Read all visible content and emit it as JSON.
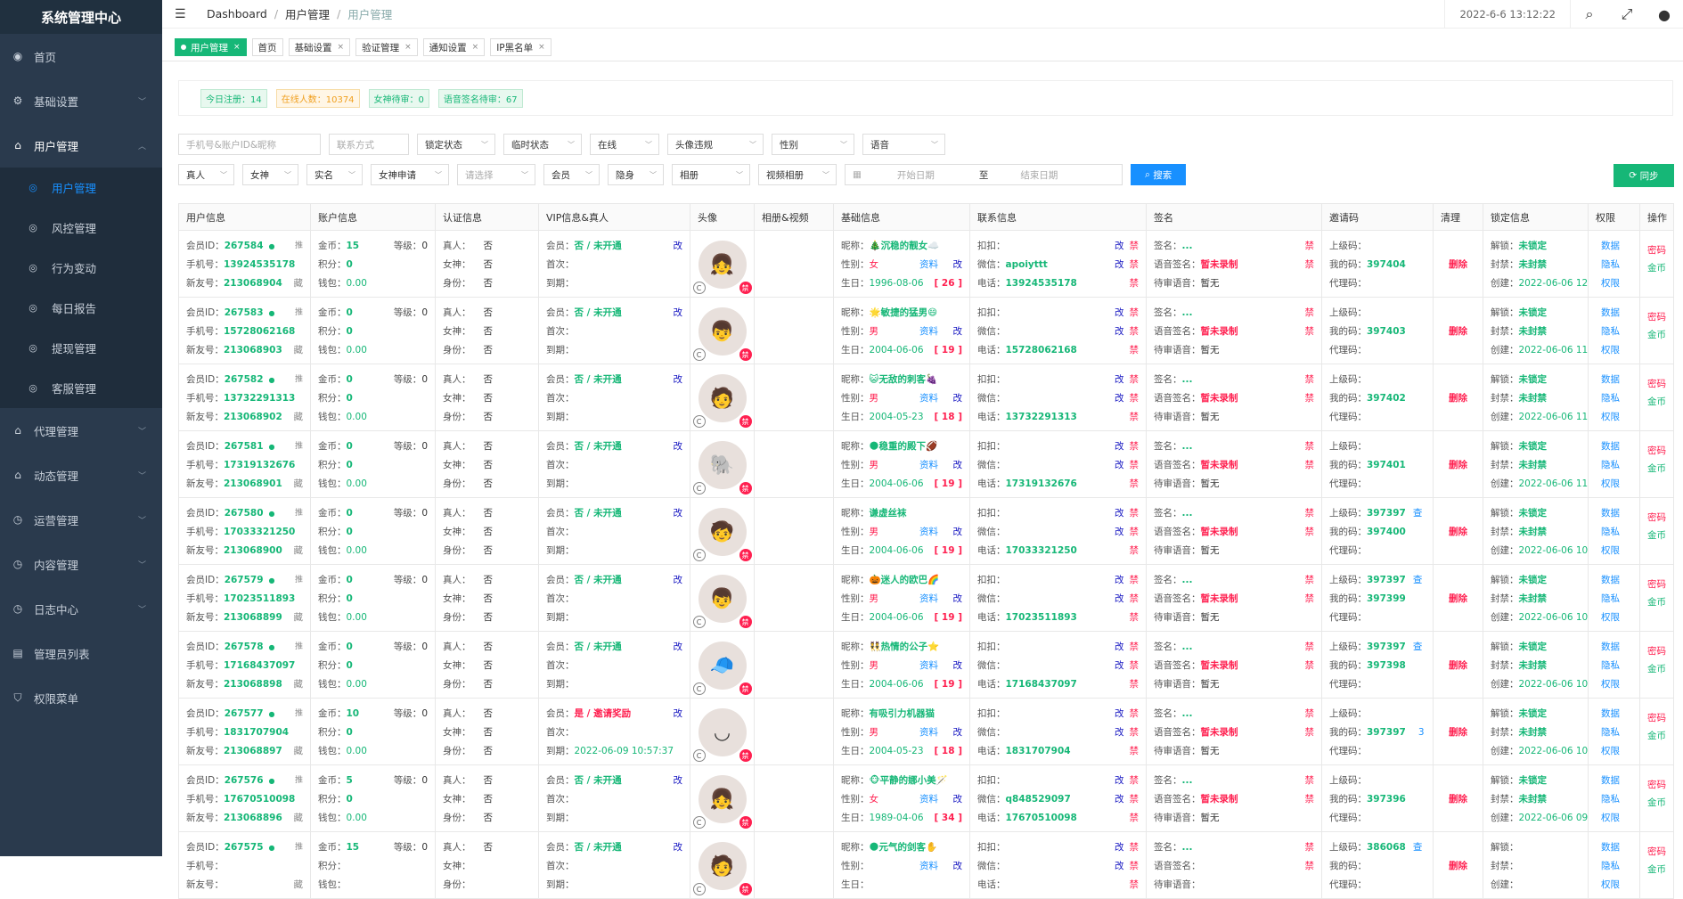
{
  "app": {
    "title": "系统管理中心"
  },
  "sidebar": {
    "items": [
      {
        "label": "首页",
        "icon": "dashboard-icon",
        "glyph": "◉"
      },
      {
        "label": "基础设置",
        "icon": "gear-icon",
        "glyph": "⚙"
      },
      {
        "label": "用户管理",
        "icon": "users-icon",
        "glyph": "⌂"
      },
      {
        "label": "代理管理",
        "icon": "agent-icon",
        "glyph": "⌂"
      },
      {
        "label": "动态管理",
        "icon": "dynamic-icon",
        "glyph": "⌂"
      },
      {
        "label": "运营管理",
        "icon": "operation-icon",
        "glyph": "◷"
      },
      {
        "label": "内容管理",
        "icon": "content-icon",
        "glyph": "◷"
      },
      {
        "label": "日志中心",
        "icon": "log-icon",
        "glyph": "◷"
      },
      {
        "label": "管理员列表",
        "icon": "admin-list-icon",
        "glyph": "▤"
      },
      {
        "label": "权限菜单",
        "icon": "permission-icon",
        "glyph": "⛉"
      }
    ],
    "subitems": [
      "用户管理",
      "风控管理",
      "行为变动",
      "每日报告",
      "提现管理",
      "客服管理"
    ]
  },
  "header": {
    "breadcrumb": [
      "Dashboard",
      "用户管理",
      "用户管理"
    ],
    "datetime": "2022-6-6 13:12:22"
  },
  "tabs": [
    {
      "label": "用户管理"
    },
    {
      "label": "首页"
    },
    {
      "label": "基础设置"
    },
    {
      "label": "验证管理"
    },
    {
      "label": "通知设置"
    },
    {
      "label": "IP黑名单"
    }
  ],
  "stats": [
    "今日注册：14",
    "在线人数：10374",
    "女神待审：0",
    "语音签名待审：67"
  ],
  "filters": {
    "row1": [
      {
        "ph": "手机号&账户ID&昵称",
        "w": 160
      },
      {
        "ph": "联系方式",
        "w": 90
      },
      {
        "ph": "锁定状态",
        "w": 88,
        "sel": true
      },
      {
        "ph": "临时状态",
        "w": 88,
        "sel": true
      },
      {
        "ph": "在线",
        "w": 78,
        "sel": true
      },
      {
        "ph": "头像违规",
        "w": 108,
        "sel": true
      },
      {
        "ph": "性别",
        "w": 93,
        "sel": true
      },
      {
        "ph": "语音",
        "w": 93,
        "sel": true
      }
    ],
    "row2": [
      {
        "ph": "真人",
        "w": 63,
        "sel": true
      },
      {
        "ph": "女神",
        "w": 63,
        "sel": true
      },
      {
        "ph": "实名",
        "w": 63,
        "sel": true
      },
      {
        "ph": "女神申请",
        "w": 88,
        "sel": true
      },
      {
        "ph": "请选择",
        "w": 88
      },
      {
        "ph": "会员",
        "w": 63,
        "sel": true
      },
      {
        "ph": "隐身",
        "w": 63,
        "sel": true
      },
      {
        "ph": "相册",
        "w": 88,
        "sel": true
      },
      {
        "ph": "视频相册",
        "w": 88,
        "sel": true
      }
    ],
    "date_start": "开始日期",
    "date_to": "至",
    "date_end": "结束日期",
    "search": "搜索",
    "sync": "同步"
  },
  "table": {
    "headers": [
      "用户信息",
      "账户信息",
      "认证信息",
      "VIP信息&真人",
      "头像",
      "相册&视频",
      "基础信息",
      "联系信息",
      "签名",
      "邀请码",
      "清理",
      "锁定信息",
      "权限",
      "操作"
    ],
    "rows": [
      {
        "id": "267584",
        "phone": "13924535178",
        "newid": "213068904",
        "coin": "15",
        "level": "0",
        "points": "0",
        "wallet": "0.00",
        "real": "否",
        "goddess": "否",
        "identity": "否",
        "vip": "否 / 未开通",
        "first": "",
        "expire": "",
        "avatar": "👧",
        "nick": "🎄沉稳的靓女☁️",
        "gender": "女",
        "birth": "1996-08-06",
        "age": "[ 26 ]",
        "qq": "",
        "wechat": "apoiyttt",
        "tel": "13924535178",
        "sign": "...",
        "voice": "暂未录制",
        "voicewait": "暂无",
        "parent": "",
        "mycode": "397404",
        "agent": "",
        "check": false,
        "unlock": "未锁定",
        "unban": "未封禁",
        "created": "2022-06-06 12"
      },
      {
        "id": "267583",
        "phone": "15728062168",
        "newid": "213068903",
        "coin": "0",
        "level": "0",
        "points": "0",
        "wallet": "0.00",
        "real": "否",
        "goddess": "否",
        "identity": "否",
        "vip": "否 / 未开通",
        "first": "",
        "expire": "",
        "avatar": "👦",
        "nick": "🌟敏捷的猛男😄",
        "gender": "男",
        "birth": "2004-06-06",
        "age": "[ 19 ]",
        "qq": "",
        "wechat": "",
        "tel": "15728062168",
        "sign": "...",
        "voice": "暂未录制",
        "voicewait": "暂无",
        "parent": "",
        "mycode": "397403",
        "agent": "",
        "check": false,
        "unlock": "未锁定",
        "unban": "未封禁",
        "created": "2022-06-06 11"
      },
      {
        "id": "267582",
        "phone": "13732291313",
        "newid": "213068902",
        "coin": "0",
        "level": "0",
        "points": "0",
        "wallet": "0.00",
        "real": "否",
        "goddess": "否",
        "identity": "否",
        "vip": "否 / 未开通",
        "first": "",
        "expire": "",
        "avatar": "🧑",
        "nick": "😺无敌的刺客🍇",
        "gender": "男",
        "birth": "2004-05-23",
        "age": "[ 18 ]",
        "qq": "",
        "wechat": "",
        "tel": "13732291313",
        "sign": "...",
        "voice": "暂未录制",
        "voicewait": "暂无",
        "parent": "",
        "mycode": "397402",
        "agent": "",
        "check": false,
        "unlock": "未锁定",
        "unban": "未封禁",
        "created": "2022-06-06 11"
      },
      {
        "id": "267581",
        "phone": "17319132676",
        "newid": "213068901",
        "coin": "0",
        "level": "0",
        "points": "0",
        "wallet": "0.00",
        "real": "否",
        "goddess": "否",
        "identity": "否",
        "vip": "否 / 未开通",
        "first": "",
        "expire": "",
        "avatar": "🐘",
        "nick": "🌑稳重的殿下🏈",
        "gender": "男",
        "birth": "2004-06-06",
        "age": "[ 19 ]",
        "qq": "",
        "wechat": "",
        "tel": "17319132676",
        "sign": "...",
        "voice": "暂未录制",
        "voicewait": "暂无",
        "parent": "",
        "mycode": "397401",
        "agent": "",
        "check": false,
        "unlock": "未锁定",
        "unban": "未封禁",
        "created": "2022-06-06 11"
      },
      {
        "id": "267580",
        "phone": "17033321250",
        "newid": "213068900",
        "coin": "0",
        "level": "0",
        "points": "0",
        "wallet": "0.00",
        "real": "否",
        "goddess": "否",
        "identity": "否",
        "vip": "否 / 未开通",
        "first": "",
        "expire": "",
        "avatar": "🧒",
        "nick": "谦虚丝袜",
        "gender": "男",
        "birth": "2004-06-06",
        "age": "[ 19 ]",
        "qq": "",
        "wechat": "",
        "tel": "17033321250",
        "sign": "...",
        "voice": "暂未录制",
        "voicewait": "暂无",
        "parent": "397397",
        "mycode": "397400",
        "agent": "",
        "check": true,
        "unlock": "未锁定",
        "unban": "未封禁",
        "created": "2022-06-06 10"
      },
      {
        "id": "267579",
        "phone": "17023511893",
        "newid": "213068899",
        "coin": "0",
        "level": "0",
        "points": "0",
        "wallet": "0.00",
        "real": "否",
        "goddess": "否",
        "identity": "否",
        "vip": "否 / 未开通",
        "first": "",
        "expire": "",
        "avatar": "👦",
        "nick": "🎃迷人的欧巴🌈",
        "gender": "男",
        "birth": "2004-06-06",
        "age": "[ 19 ]",
        "qq": "",
        "wechat": "",
        "tel": "17023511893",
        "sign": "...",
        "voice": "暂未录制",
        "voicewait": "暂无",
        "parent": "397397",
        "mycode": "397399",
        "agent": "",
        "check": true,
        "unlock": "未锁定",
        "unban": "未封禁",
        "created": "2022-06-06 10"
      },
      {
        "id": "267578",
        "phone": "17168437097",
        "newid": "213068898",
        "coin": "0",
        "level": "0",
        "points": "0",
        "wallet": "0.00",
        "real": "否",
        "goddess": "否",
        "identity": "否",
        "vip": "否 / 未开通",
        "first": "",
        "expire": "",
        "avatar": "🧢",
        "nick": "👯热情的公子⭐",
        "gender": "男",
        "birth": "2004-06-06",
        "age": "[ 19 ]",
        "qq": "",
        "wechat": "",
        "tel": "17168437097",
        "sign": "...",
        "voice": "暂未录制",
        "voicewait": "暂无",
        "parent": "397397",
        "mycode": "397398",
        "agent": "",
        "check": true,
        "unlock": "未锁定",
        "unban": "未封禁",
        "created": "2022-06-06 10"
      },
      {
        "id": "267577",
        "phone": "1831707904",
        "newid": "213068897",
        "coin": "10",
        "level": "0",
        "points": "0",
        "wallet": "0.00",
        "real": "否",
        "goddess": "否",
        "identity": "否",
        "vip": "是 / 邀请奖励",
        "first": "",
        "expire": "2022-06-09 10:57:37",
        "avatar": "◡",
        "nick": "有吸引力机器猫",
        "gender": "男",
        "birth": "2004-05-23",
        "age": "[ 18 ]",
        "qq": "",
        "wechat": "",
        "tel": "1831707904",
        "sign": "...",
        "voice": "暂未录制",
        "voicewait": "暂无",
        "parent": "",
        "mycode": "397397",
        "agent": "",
        "invites": "3",
        "check": false,
        "unlock": "未锁定",
        "unban": "未封禁",
        "created": "2022-06-06 10"
      },
      {
        "id": "267576",
        "phone": "17670510098",
        "newid": "213068896",
        "coin": "5",
        "level": "0",
        "points": "0",
        "wallet": "0.00",
        "real": "否",
        "goddess": "否",
        "identity": "否",
        "vip": "否 / 未开通",
        "first": "",
        "expire": "",
        "avatar": "👧",
        "nick": "🐵平静的娜小美🪄",
        "gender": "女",
        "birth": "1989-04-06",
        "age": "[ 34 ]",
        "qq": "",
        "wechat": "q848529097",
        "tel": "17670510098",
        "sign": "...",
        "voice": "暂未录制",
        "voicewait": "暂无",
        "parent": "",
        "mycode": "397396",
        "agent": "",
        "check": false,
        "unlock": "未锁定",
        "unban": "未封禁",
        "created": "2022-06-06 09"
      },
      {
        "id": "267575",
        "phone": "",
        "newid": "",
        "coin": "15",
        "level": "0",
        "points": "",
        "wallet": "",
        "real": "否",
        "goddess": "",
        "identity": "",
        "vip": "否 / 未开通",
        "first": "",
        "expire": "",
        "avatar": "🧑",
        "nick": "🌑元气的剑客✋",
        "gender": "",
        "birth": "",
        "age": "",
        "qq": "",
        "wechat": "",
        "tel": "",
        "sign": "...",
        "voice": "",
        "voicewait": "",
        "parent": "386068",
        "mycode": "",
        "agent": "",
        "check": true,
        "unlock": "",
        "unban": "",
        "created": ""
      }
    ]
  },
  "labels": {
    "member_id": "会员ID：",
    "phone": "手机号：",
    "newid": "新友号：",
    "coin": "金币：",
    "level": "等级：",
    "points": "积分：",
    "wallet": "钱包：",
    "real": "真人：",
    "goddess": "女神：",
    "identity": "身份：",
    "vip": "会员：",
    "first": "首次：",
    "expire": "到期：",
    "nick": "昵称：",
    "gender": "性别：",
    "birth": "生日：",
    "qq": "扣扣：",
    "wechat": "微信：",
    "tel": "电话：",
    "sign": "签名：",
    "voice": "语音签名：",
    "voicewait": "待审语音：",
    "parent": "上级码：",
    "mycode": "我的码：",
    "agent": "代理码：",
    "unlock": "解锁：",
    "unban": "封禁：",
    "created": "创建：",
    "edit": "改",
    "ban": "禁",
    "profile": "资料",
    "hide": "藏",
    "check": "查",
    "delete": "删除",
    "perm_data": "数据",
    "perm_privacy": "隐私",
    "perm_auth": "权限",
    "op_pwd": "密码",
    "op_coin": "金币"
  }
}
